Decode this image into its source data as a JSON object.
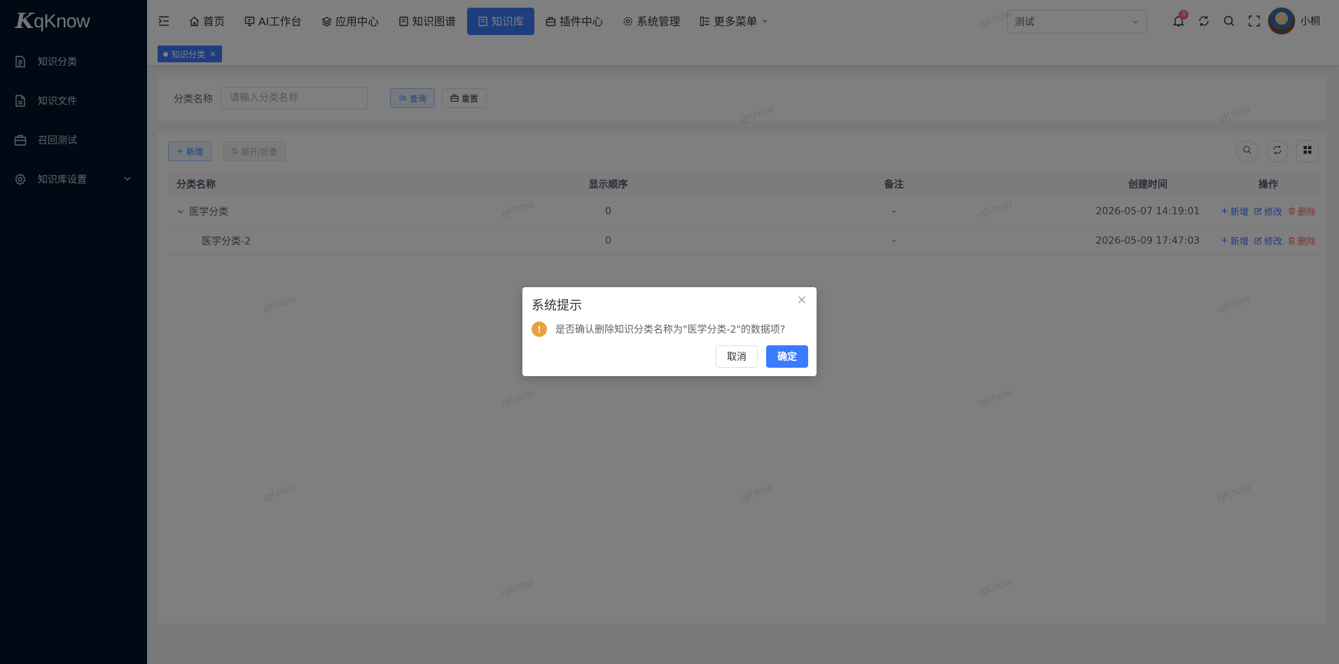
{
  "brand": {
    "mark": "K",
    "name": "qKnow"
  },
  "sidebar": {
    "items": [
      {
        "label": "知识分类",
        "icon": "document-list-icon"
      },
      {
        "label": "知识文件",
        "icon": "file-icon"
      },
      {
        "label": "召回测试",
        "icon": "briefcase-icon"
      },
      {
        "label": "知识库设置",
        "icon": "gear-icon",
        "expandable": true
      }
    ]
  },
  "header": {
    "nav": [
      {
        "label": "首页",
        "icon": "home-icon",
        "active": false
      },
      {
        "label": "AI工作台",
        "icon": "monitor-icon",
        "active": false
      },
      {
        "label": "应用中心",
        "icon": "layers-icon",
        "active": false
      },
      {
        "label": "知识图谱",
        "icon": "book-icon",
        "active": false
      },
      {
        "label": "知识库",
        "icon": "book-icon",
        "active": true
      },
      {
        "label": "插件中心",
        "icon": "toolbox-icon",
        "active": false
      },
      {
        "label": "系统管理",
        "icon": "gear-icon",
        "active": false
      },
      {
        "label": "更多菜单",
        "icon": "tree-menu-icon",
        "active": false,
        "dropdown": true
      }
    ],
    "tenant": "测试",
    "notification_count": "3",
    "username": "小桐"
  },
  "tags": [
    {
      "label": "知识分类",
      "active": true
    }
  ],
  "search": {
    "label": "分类名称",
    "placeholder": "请输入分类名称",
    "query_button": "查询",
    "reset_button": "重置"
  },
  "toolbar": {
    "add_button": "新增",
    "toggle_button": "展开/折叠"
  },
  "table": {
    "columns": [
      "分类名称",
      "显示顺序",
      "备注",
      "创建时间",
      "操作"
    ],
    "rows": [
      {
        "name": "医学分类",
        "order": "0",
        "remark": "-",
        "created": "2026-05-07 14:19:01",
        "expanded": true,
        "level": 0
      },
      {
        "name": "医学分类-2",
        "order": "0",
        "remark": "-",
        "created": "2026-05-09 17:47:03",
        "level": 1
      }
    ],
    "actions": {
      "add": "新增",
      "edit": "修改",
      "delete": "删除"
    }
  },
  "watermark": "qKnow",
  "dialog": {
    "title": "系统提示",
    "message": "是否确认删除知识分类名称为\"医学分类-2\"的数据项?",
    "cancel": "取消",
    "confirm": "确定"
  },
  "colors": {
    "primary": "#3a7afe",
    "sidebar": "#001529",
    "danger": "#f56c6c",
    "warning": "#e6a23c"
  }
}
